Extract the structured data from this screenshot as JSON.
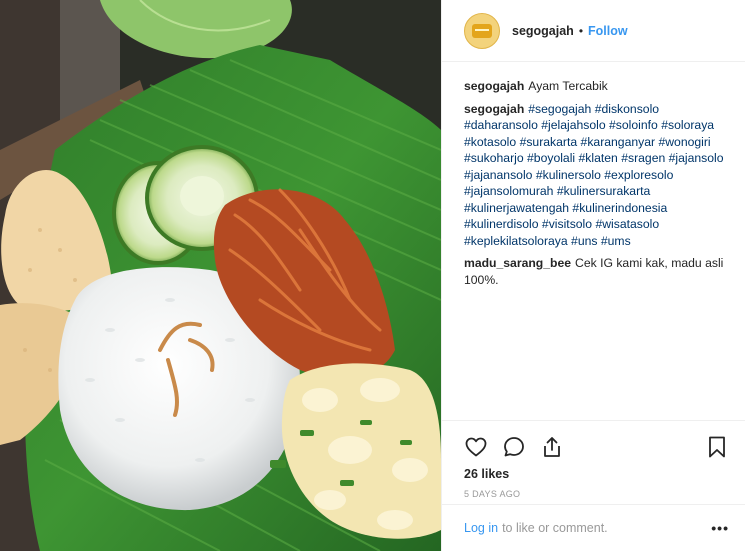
{
  "post": {
    "username": "segogajah",
    "separator": "•",
    "follow_label": "Follow",
    "brand_color": "#3897f0"
  },
  "comments": [
    {
      "user": "segogajah",
      "parts": [
        {
          "type": "text",
          "value": "Ayam Tercabik"
        }
      ]
    },
    {
      "user": "segogajah",
      "parts": [
        {
          "type": "tag",
          "value": "#segogajah"
        },
        {
          "type": "tag",
          "value": "#diskonsolo"
        },
        {
          "type": "tag",
          "value": "#daharansolo"
        },
        {
          "type": "tag",
          "value": "#jelajahsolo"
        },
        {
          "type": "tag",
          "value": "#soloinfo"
        },
        {
          "type": "tag",
          "value": "#soloraya"
        },
        {
          "type": "tag",
          "value": "#kotasolo"
        },
        {
          "type": "tag",
          "value": "#surakarta"
        },
        {
          "type": "tag",
          "value": "#karanganyar"
        },
        {
          "type": "tag",
          "value": "#wonogiri"
        },
        {
          "type": "tag",
          "value": "#sukoharjo"
        },
        {
          "type": "tag",
          "value": "#boyolali"
        },
        {
          "type": "tag",
          "value": "#klaten"
        },
        {
          "type": "tag",
          "value": "#sragen"
        },
        {
          "type": "tag",
          "value": "#jajansolo"
        },
        {
          "type": "tag",
          "value": "#jajanansolo"
        },
        {
          "type": "tag",
          "value": "#kulinersolo"
        },
        {
          "type": "tag",
          "value": "#exploresolo"
        },
        {
          "type": "tag",
          "value": "#jajansolomurah"
        },
        {
          "type": "tag",
          "value": "#kulinersurakarta"
        },
        {
          "type": "tag",
          "value": "#kulinerjawatengah"
        },
        {
          "type": "tag",
          "value": "#kulinerindonesia"
        },
        {
          "type": "tag",
          "value": "#kulinerdisolo"
        },
        {
          "type": "tag",
          "value": "#visitsolo"
        },
        {
          "type": "tag",
          "value": "#wisatasolo"
        },
        {
          "type": "tag",
          "value": "#keplekilatsoloraya"
        },
        {
          "type": "tag",
          "value": "#uns"
        },
        {
          "type": "tag",
          "value": "#ums"
        }
      ]
    },
    {
      "user": "madu_sarang_bee",
      "parts": [
        {
          "type": "text",
          "value": "Cek IG kami kak, madu asli 100%."
        }
      ]
    }
  ],
  "actions": {
    "like_icon": "heart-icon",
    "comment_icon": "comment-bubble-icon",
    "share_icon": "share-upload-icon",
    "save_icon": "bookmark-icon"
  },
  "likes_text": "26 likes",
  "time_text": "5 DAYS AGO",
  "footer": {
    "login_label": "Log in",
    "login_suffix": "to like or comment.",
    "more_label": "•••"
  }
}
